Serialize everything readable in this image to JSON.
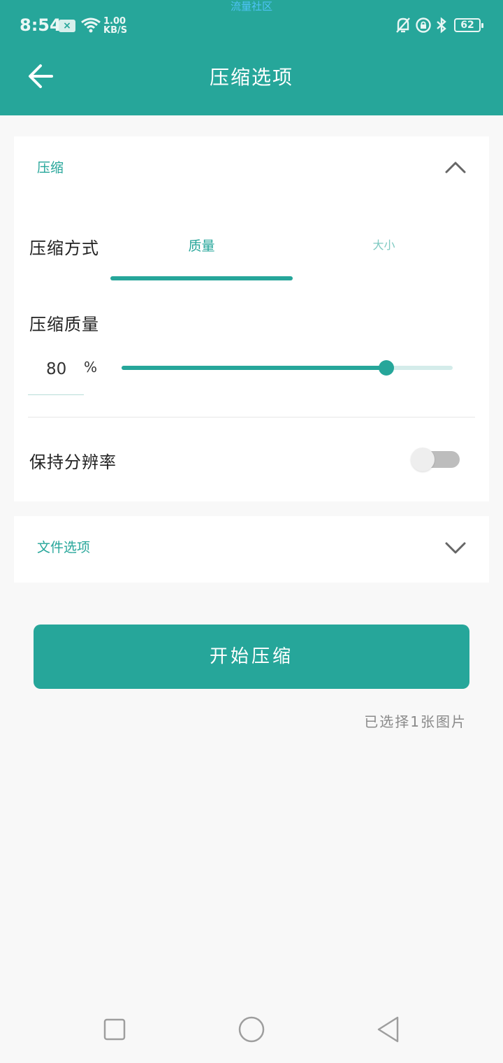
{
  "status_bar": {
    "time": "8:54",
    "notification_badge": "×",
    "speed_value": "1.00",
    "speed_unit": "KB/S",
    "carrier_label": "流量社区",
    "battery": "62",
    "icons": [
      "wifi-icon",
      "bell-off-icon",
      "orientation-lock-icon",
      "bluetooth-icon",
      "battery-icon"
    ]
  },
  "appbar": {
    "title": "压缩选项",
    "back_icon": "arrow-left-icon"
  },
  "compress_section": {
    "header": "压缩",
    "expanded": true,
    "method_label": "压缩方式",
    "tabs": [
      {
        "label": "质量",
        "selected": true
      },
      {
        "label": "大小",
        "selected": false
      }
    ],
    "quality_label": "压缩质量",
    "quality_value": "80",
    "quality_unit": "%",
    "quality_slider_fraction": 0.8,
    "keep_resolution_label": "保持分辨率",
    "keep_resolution_on": false
  },
  "file_section": {
    "header": "文件选项",
    "expanded": false
  },
  "start_button_label": "开始压缩",
  "selected_info": "已选择1张图片",
  "colors": {
    "primary": "#26a69a",
    "primary_light": "#d4ecea",
    "switch_off": "#bdbdbd"
  },
  "nav": [
    "recent-apps-square-icon",
    "home-circle-icon",
    "back-triangle-icon"
  ]
}
